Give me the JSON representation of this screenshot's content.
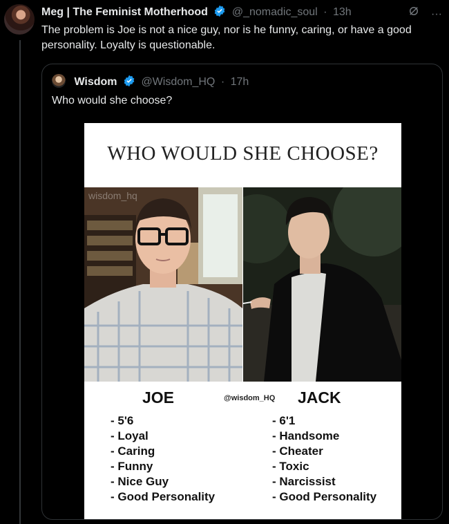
{
  "tweet": {
    "author_name": "Meg | The Feminist Motherhood",
    "handle": "@_nomadic_soul",
    "time": "13h",
    "text": "The problem is Joe is not a nice guy, nor is he funny, caring, or have a good personality. Loyalty is questionable."
  },
  "quoted": {
    "author_name": "Wisdom",
    "handle": "@Wisdom_HQ",
    "time": "17h",
    "text": "Who would she choose?"
  },
  "meme": {
    "title": "WHO WOULD SHE CHOOSE?",
    "photo_watermark": "wisdom_hq",
    "watermark": "@wisdom_HQ",
    "left_name": "JOE",
    "right_name": "JACK",
    "left_traits": [
      "- 5'6",
      "- Loyal",
      "- Caring",
      "- Funny",
      "- Nice Guy",
      "- Good Personality"
    ],
    "right_traits": [
      "- 6'1",
      "- Handsome",
      "- Cheater",
      "- Toxic",
      "- Narcissist",
      "- Good Personality"
    ]
  },
  "colors": {
    "background": "#000000",
    "text": "#e7e9ea",
    "muted": "#71767b",
    "verified": "#1d9bf0"
  },
  "icons": [
    "grok-icon",
    "more-icon",
    "verified-icon"
  ]
}
